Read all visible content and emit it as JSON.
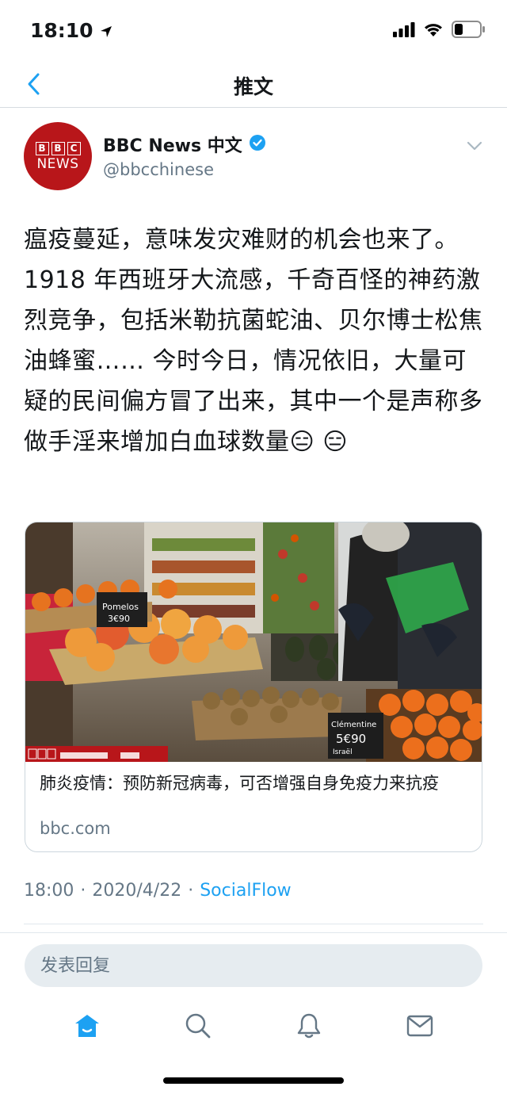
{
  "status_bar": {
    "time": "18:10",
    "icons": [
      "location-arrow-icon",
      "cellular-signal-icon",
      "wifi-icon",
      "battery-icon"
    ]
  },
  "nav": {
    "back_icon": "chevron-left-icon",
    "title": "推文"
  },
  "tweet": {
    "author": {
      "avatar_logo_text": "BBC NEWS",
      "name": "BBC News 中文",
      "verified_icon": "verified-badge-icon",
      "handle": "@bbcchinese"
    },
    "more_icon": "chevron-down-icon",
    "text": "瘟疫蔓延，意味发灾难财的机会也来了。1918 年西班牙大流感，千奇百怪的神药激烈竞争，包括米勒抗菌蛇油、贝尔博士松焦油蜂蜜…… 今时今日，情况依旧，大量可疑的民间偏方冒了出来，其中一个是声称多做手淫来增加白血球数量😑 😑",
    "card": {
      "title": "肺炎疫情：预防新冠病毒，可否增强自身免疫力来抗疫",
      "domain": "bbc.com",
      "image_sign_text": "Clémentine 5€90 Israël"
    },
    "meta": {
      "time": "18:00",
      "separator": "·",
      "date": "2020/4/22",
      "source": "SocialFlow"
    }
  },
  "reply": {
    "placeholder": "发表回复"
  },
  "tab_bar": {
    "items": [
      "home-icon",
      "search-icon",
      "notifications-bell-icon",
      "messages-envelope-icon"
    ],
    "accent": "#1da1f2",
    "inactive": "#657786"
  }
}
